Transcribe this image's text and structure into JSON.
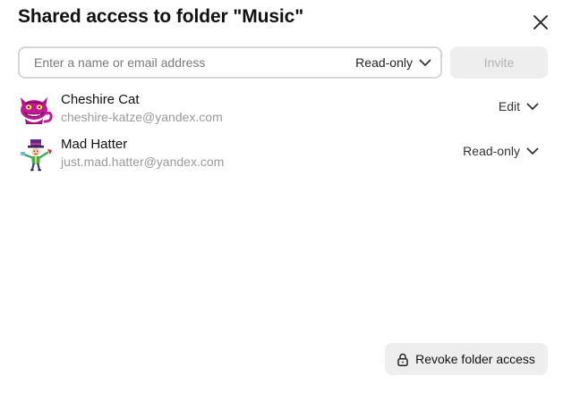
{
  "dialog": {
    "title": "Shared access to folder \"Music\"",
    "close_icon": "close-icon"
  },
  "invite": {
    "placeholder": "Enter a name or email address",
    "value": "",
    "permission": "Read-only",
    "button_label": "Invite",
    "button_enabled": false
  },
  "members": [
    {
      "name": "Cheshire Cat",
      "email": "cheshire-katze@yandex.com",
      "permission": "Edit",
      "avatar": "cheshire-cat-avatar"
    },
    {
      "name": "Mad Hatter",
      "email": "just.mad.hatter@yandex.com",
      "permission": "Read-only",
      "avatar": "mad-hatter-avatar"
    }
  ],
  "footer": {
    "revoke_label": "Revoke folder access",
    "revoke_icon": "lock-icon"
  },
  "colors": {
    "button_bg": "#eeeeee",
    "disabled_text": "#b3b3b3",
    "muted_text": "#9a9a9a",
    "field_border": "#d6d6d6"
  }
}
